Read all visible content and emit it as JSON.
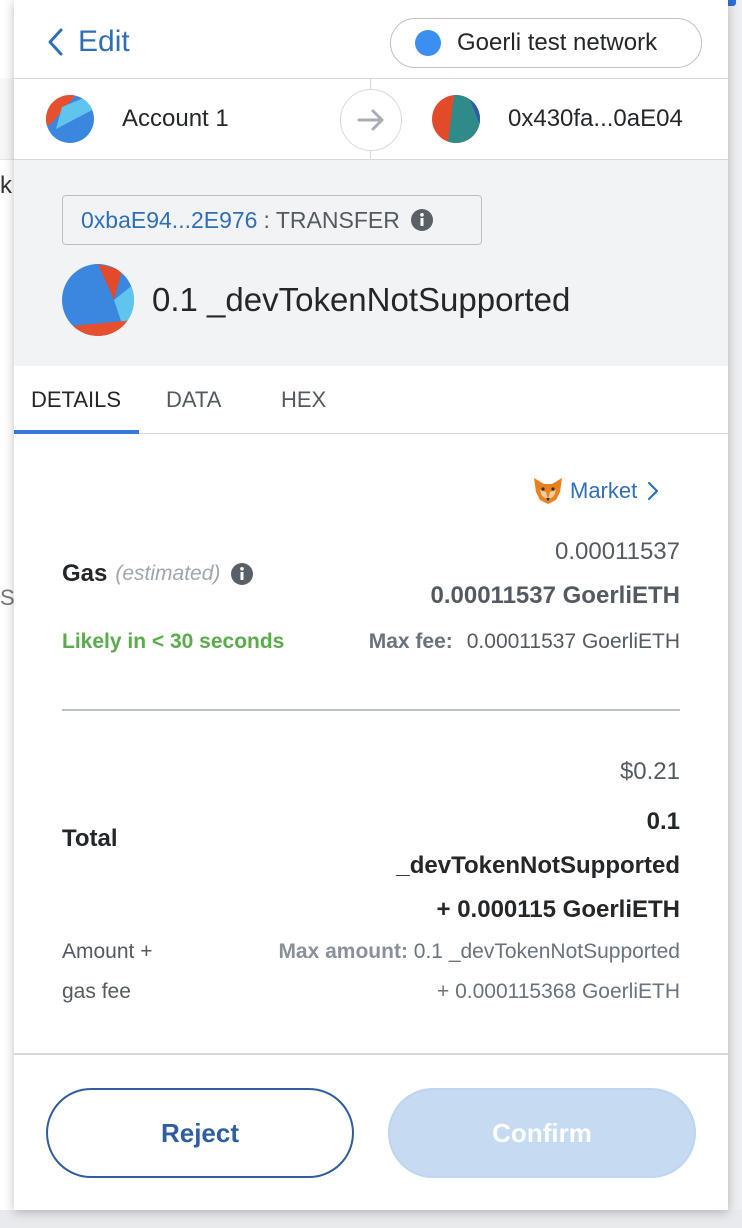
{
  "header": {
    "edit_label": "Edit",
    "network_label": "Goerli test network",
    "network_color": "#3a8ff1"
  },
  "accounts": {
    "from_label": "Account 1",
    "to_label": "0x430fa...0aE04"
  },
  "summary": {
    "contract_address": "0xbaE94...2E976",
    "separator": ":",
    "method": "TRANSFER",
    "token_amount": "0.1 _devTokenNotSupported"
  },
  "tabs": [
    {
      "label": "DETAILS",
      "active": true
    },
    {
      "label": "DATA",
      "active": false
    },
    {
      "label": "HEX",
      "active": false
    }
  ],
  "gas": {
    "market_label": "Market",
    "title": "Gas",
    "estimated_label": "(estimated)",
    "secondary_value": "0.00011537",
    "primary_value": "0.00011537 GoerliETH",
    "likely_text": "Likely in < 30 seconds",
    "max_fee_label": "Max fee:",
    "max_fee_value": "0.00011537 GoerliETH"
  },
  "total": {
    "label": "Total",
    "secondary_value": "$0.21",
    "primary_line1": "0.1",
    "primary_line2": "_devTokenNotSupported",
    "primary_line3": "+ 0.000115 GoerliETH",
    "amount_gas_line1": "Amount +",
    "amount_gas_line2": "gas fee",
    "max_amount_label": "Max amount:",
    "max_amount_line1": "0.1 _devTokenNotSupported",
    "max_amount_line2": "+ 0.000115368 GoerliETH"
  },
  "buttons": {
    "reject_label": "Reject",
    "confirm_label": "Confirm"
  },
  "colors": {
    "link_blue": "#2f6fb8",
    "success_green": "#5aab4b",
    "confirm_disabled": "#c6daf2"
  }
}
